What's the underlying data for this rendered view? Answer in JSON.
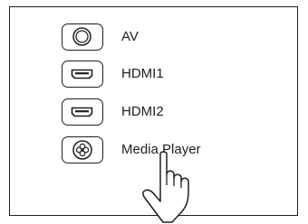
{
  "sources": [
    {
      "label": "AV",
      "icon": "av-jack-icon"
    },
    {
      "label": "HDMI1",
      "icon": "hdmi-port-icon"
    },
    {
      "label": "HDMI2",
      "icon": "hdmi-port-icon"
    },
    {
      "label": "Media Player",
      "icon": "media-player-icon"
    }
  ],
  "pointer": {
    "icon": "pointing-hand-icon"
  },
  "colors": {
    "stroke": "#1e1e1e",
    "background": "#ffffff"
  }
}
